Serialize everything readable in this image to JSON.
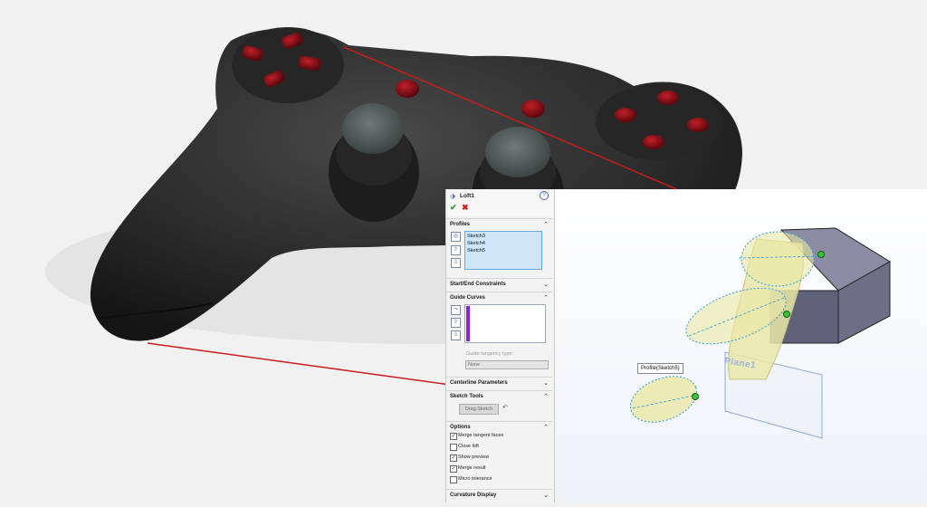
{
  "feature": {
    "title": "Loft1"
  },
  "profiles": {
    "title": "Profiles",
    "items": [
      "Sketch3",
      "Sketch4",
      "Sketch5"
    ]
  },
  "start_end": {
    "title": "Start/End Constraints"
  },
  "guide_curves": {
    "title": "Guide Curves",
    "tangency_label": "Guide tangency type:",
    "tangency_value": "None"
  },
  "centerline": {
    "title": "Centerline Parameters"
  },
  "sketch_tools": {
    "title": "Sketch Tools",
    "drag_button": "Drag Sketch"
  },
  "options": {
    "title": "Options",
    "items": [
      {
        "label": "Merge tangent faces",
        "checked": "✓"
      },
      {
        "label": "Close loft",
        "checked": ""
      },
      {
        "label": "Show preview",
        "checked": "✓"
      },
      {
        "label": "Merge result",
        "checked": "✓"
      },
      {
        "label": "Micro tolerance",
        "checked": ""
      }
    ]
  },
  "curvature": {
    "title": "Curvature Display"
  },
  "viewport": {
    "tooltip": "Profile(Sketch5)",
    "plane_label": "Plane1"
  },
  "icons": {
    "ok": "check-icon",
    "cancel": "close-icon",
    "help": "help-icon",
    "loft": "loft-feature-icon"
  },
  "colors": {
    "controller_body": "#2b2b2b",
    "buttons": "#7a0b12",
    "callout_line": "#cc1b1b",
    "loft_fill": "#e9e7a8",
    "box": "#6e6f86",
    "accent": "#6aa8d8"
  }
}
